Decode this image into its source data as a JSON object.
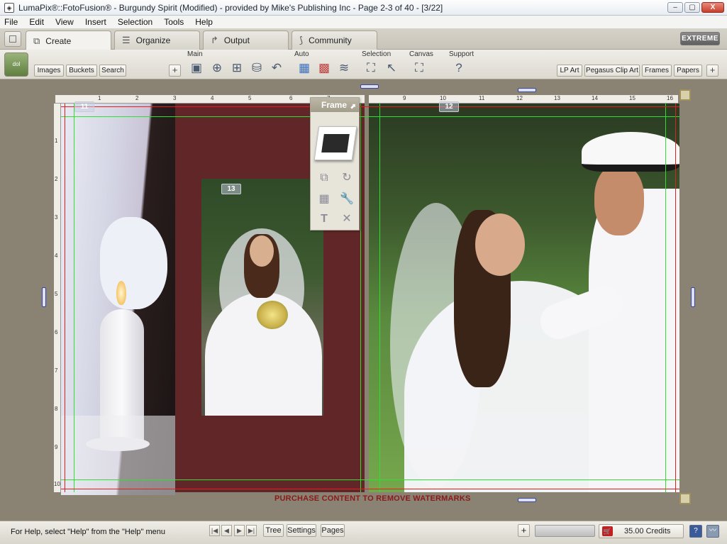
{
  "window": {
    "title": "LumaPix®::FotoFusion® - Burgundy Spirit (Modified) - provided by Mike's Publishing Inc - Page 2-3 of 40 - [3/22]",
    "minimize": "▭",
    "restore": "▢",
    "close": "X"
  },
  "menu": [
    "File",
    "Edit",
    "View",
    "Insert",
    "Selection",
    "Tools",
    "Help"
  ],
  "tabs": [
    {
      "label": "Create",
      "icon": "create-icon"
    },
    {
      "label": "Organize",
      "icon": "list-icon"
    },
    {
      "label": "Output",
      "icon": "arrow-icon"
    },
    {
      "label": "Community",
      "icon": "community-icon"
    }
  ],
  "edition": "EXTREME",
  "toolbar": {
    "logo": "dol",
    "left_buttons": [
      "Images",
      "Buckets",
      "Search"
    ],
    "plus": "+",
    "groups": {
      "main": "Main",
      "auto": "Auto",
      "selection": "Selection",
      "canvas": "Canvas",
      "support": "Support"
    },
    "right_buttons": [
      "LP Art",
      "Pegasus Clip Art",
      "Frames",
      "Papers"
    ]
  },
  "canvas": {
    "page_numbers": [
      "11",
      "12",
      "13"
    ],
    "ruler_h_left": [
      "1",
      "2",
      "3",
      "4",
      "5",
      "6",
      "7",
      "8"
    ],
    "ruler_h_right": [
      "9",
      "10",
      "11",
      "12",
      "13",
      "14",
      "15",
      "16"
    ],
    "ruler_v": [
      "1",
      "2",
      "3",
      "4",
      "5",
      "6",
      "7",
      "8",
      "9",
      "10"
    ],
    "watermark": "PURCHASE CONTENT TO REMOVE WATERMARKS"
  },
  "frame_panel": {
    "title": "Frame",
    "pin": "⬈"
  },
  "status": {
    "help": "For Help, select \"Help\" from the \"Help\" menu",
    "nav": [
      "|◀",
      "◀",
      "▶",
      "▶|"
    ],
    "buttons": [
      "Tree",
      "Settings",
      "Pages"
    ],
    "plus": "+",
    "credits": "35.00 Credits",
    "help_btn": "?"
  }
}
